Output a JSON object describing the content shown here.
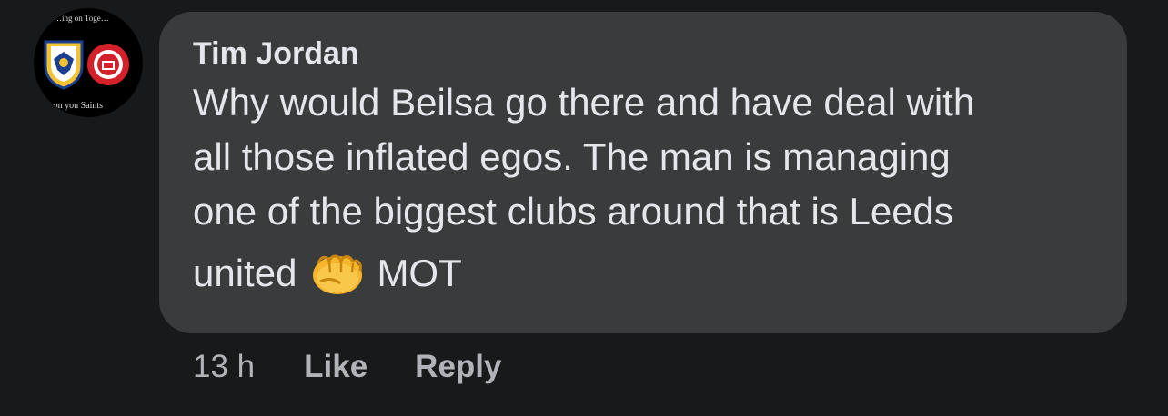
{
  "avatar": {
    "top_text": "…ing on Toge…",
    "bottom_text": "'mon you Saints",
    "left_crest": "leeds-united-crest-icon",
    "right_crest": "st-patricks-athletic-crest-icon"
  },
  "comment": {
    "author": "Tim Jordan",
    "text_lines": [
      "Why would Beilsa go there and have deal with",
      "all those inflated egos. The man is managing",
      "one of the biggest clubs around that is Leeds"
    ],
    "last_line_before_emoji": "united",
    "emoji": "oncoming-fist-icon",
    "last_line_after_emoji": "MOT"
  },
  "actions": {
    "time": "13 h",
    "like_label": "Like",
    "reply_label": "Reply"
  },
  "colors": {
    "background": "#18191a",
    "bubble": "#3a3b3c",
    "text": "#e4e6eb",
    "secondary_text": "#b0b3b8"
  }
}
